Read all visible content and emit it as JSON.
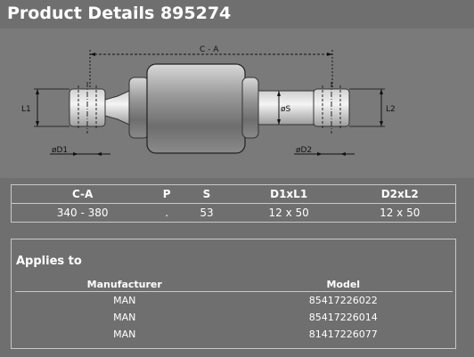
{
  "page": {
    "title": "Product Details 895274"
  },
  "drawing": {
    "labels": {
      "ca": "C - A",
      "l1": "L1",
      "l2": "L2",
      "s": "øS",
      "d1": "øD1",
      "d2": "øD2"
    }
  },
  "specs": {
    "headers": [
      "C-A",
      "P",
      "S",
      "D1xL1",
      "D2xL2"
    ],
    "row": [
      "340 - 380",
      ".",
      "53",
      "12 x 50",
      "12 x 50"
    ]
  },
  "applies": {
    "title": "Applies to",
    "headers": [
      "Manufacturer",
      "Model"
    ],
    "rows": [
      [
        "MAN",
        "85417226022"
      ],
      [
        "MAN",
        "85417226014"
      ],
      [
        "MAN",
        "81417226077"
      ]
    ]
  },
  "colors": {
    "background": "#6f6f6f",
    "border": "#c8c8c8",
    "text": "#ffffff"
  }
}
